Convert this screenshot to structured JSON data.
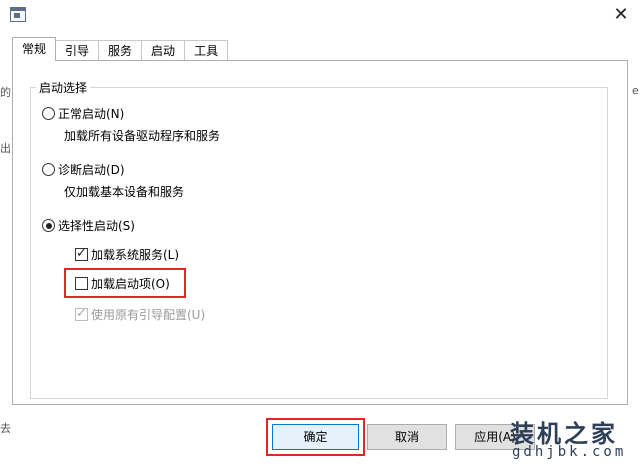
{
  "background_fragments": {
    "left_1": "的",
    "left_2": "出",
    "left_3": "去",
    "right_1": "e"
  },
  "window": {
    "close_glyph": "✕"
  },
  "tabs": [
    {
      "label": "常规",
      "active": true
    },
    {
      "label": "引导",
      "active": false
    },
    {
      "label": "服务",
      "active": false
    },
    {
      "label": "启动",
      "active": false
    },
    {
      "label": "工具",
      "active": false
    }
  ],
  "startup": {
    "group_title": "启动选择",
    "normal": {
      "label": "正常启动(N)",
      "desc": "加载所有设备驱动程序和服务",
      "selected": false
    },
    "diagnostic": {
      "label": "诊断启动(D)",
      "desc": "仅加载基本设备和服务",
      "selected": false
    },
    "selective": {
      "label": "选择性启动(S)",
      "selected": true
    },
    "options": {
      "load_services": {
        "label": "加载系统服务(L)",
        "checked": true,
        "enabled": true
      },
      "load_startup": {
        "label": "加载启动项(O)",
        "checked": false,
        "enabled": true
      },
      "use_original_boot": {
        "label": "使用原有引导配置(U)",
        "checked": true,
        "enabled": false
      }
    }
  },
  "buttons": {
    "ok": "确定",
    "cancel": "取消",
    "apply": "应用(A)"
  },
  "watermark": {
    "main": "装机之家",
    "sub": "gdhjbk.com"
  },
  "colors": {
    "highlight": "#e3262a",
    "default_button_border": "#0078d7"
  }
}
